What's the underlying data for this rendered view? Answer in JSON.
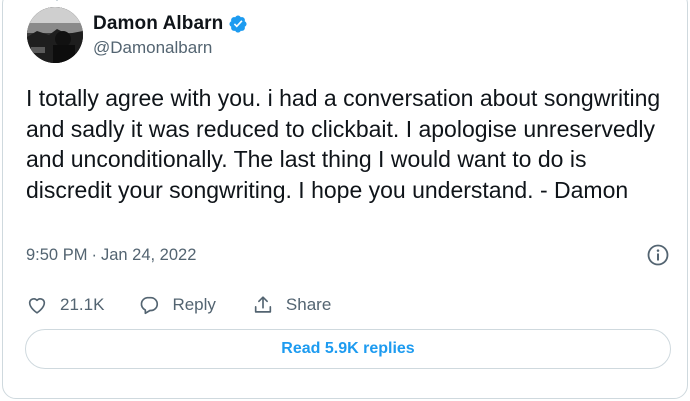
{
  "user": {
    "display_name": "Damon Albarn",
    "handle": "@Damonalbarn",
    "verified": true
  },
  "tweet": {
    "text": "I totally agree with you. i had a conversation about songwriting and sadly it was reduced to clickbait. I apologise unreservedly and unconditionally. The last thing I would want to do is discredit your songwriting. I hope you understand. - Damon",
    "time": "9:50 PM",
    "separator": "·",
    "date": "Jan 24, 2022"
  },
  "actions": {
    "like_count": "21.1K",
    "reply_label": "Reply",
    "share_label": "Share"
  },
  "replies_button": {
    "label": "Read 5.9K replies"
  },
  "icons": {
    "verified": "verified-badge-icon",
    "info": "info-icon",
    "like": "heart-icon",
    "reply": "speech-bubble-icon",
    "share": "share-upload-icon"
  },
  "colors": {
    "accent": "#1d9bf0",
    "text": "#0f1419",
    "secondary": "#536471",
    "border": "#cfd9de"
  }
}
